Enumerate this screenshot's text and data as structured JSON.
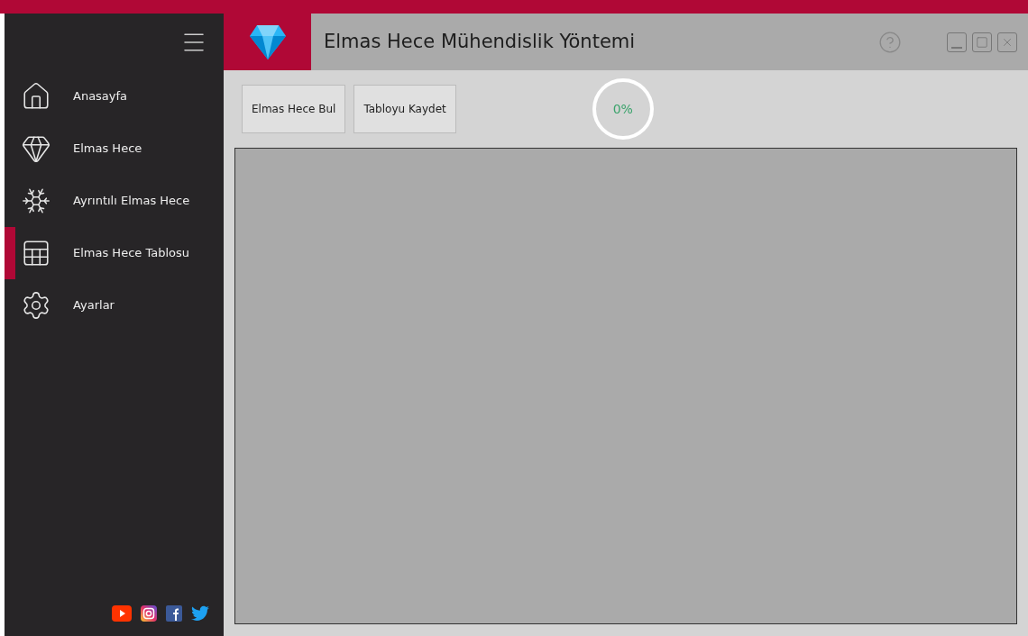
{
  "window": {
    "title": "Elmas Hece Mühendislik Yöntemi"
  },
  "sidebar": {
    "items": [
      {
        "label": "Anasayfa",
        "kind": "home",
        "selected": false
      },
      {
        "label": "Elmas Hece",
        "kind": "gem",
        "selected": false
      },
      {
        "label": "Ayrıntılı Elmas Hece",
        "kind": "snowflake",
        "selected": false
      },
      {
        "label": "Elmas Hece Tablosu",
        "kind": "table",
        "selected": true
      },
      {
        "label": "Ayarlar",
        "kind": "settings",
        "selected": false
      }
    ]
  },
  "toolbar": {
    "buttons": [
      "Elmas Hece Bul",
      "Tabloyu Kaydet"
    ],
    "progress": {
      "label": "0%",
      "level": 0
    }
  }
}
